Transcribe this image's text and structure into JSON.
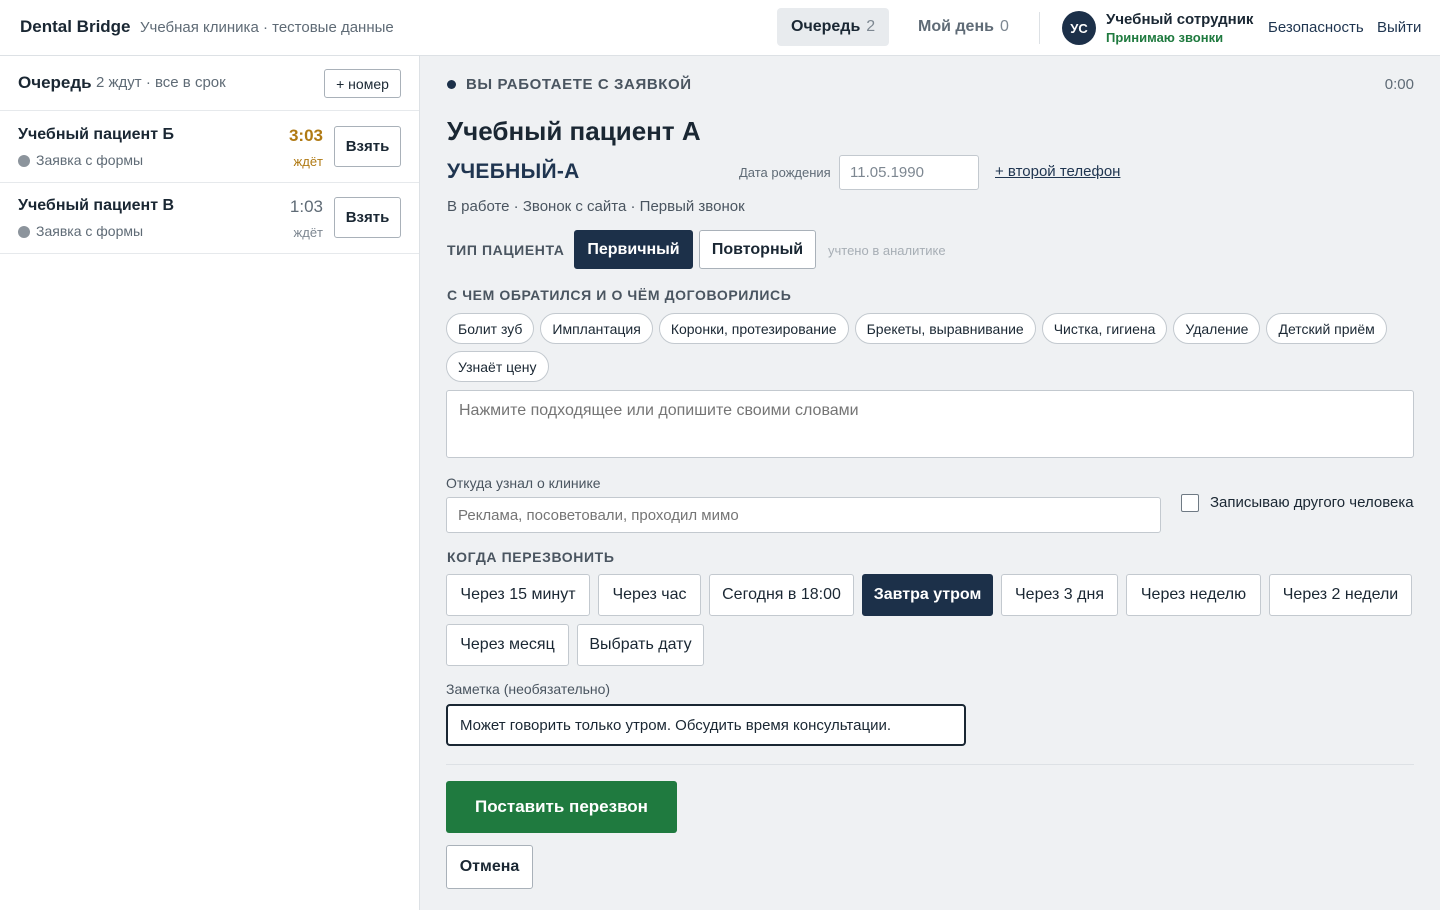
{
  "header": {
    "brand": "Dental Bridge",
    "subtitle": "Учебная клиника · тестовые данные",
    "tabs": [
      {
        "label": "Очередь",
        "count": "2",
        "active": true
      },
      {
        "label": "Мой день",
        "count": "0",
        "active": false
      }
    ],
    "user": {
      "initials": "УС",
      "name": "Учебный сотрудник",
      "status": "Принимаю звонки"
    },
    "links": {
      "security": "Безопасность",
      "logout": "Выйти"
    }
  },
  "sidebar": {
    "title": "Очередь",
    "meta": "2 ждут · все в срок",
    "add_button": "+ номер",
    "items": [
      {
        "name": "Учебный пациент Б",
        "source": "Заявка с формы",
        "time": "3:03",
        "wait": "ждёт",
        "take": "Взять"
      },
      {
        "name": "Учебный пациент В",
        "source": "Заявка с формы",
        "time": "1:03",
        "wait": "ждёт",
        "take": "Взять"
      }
    ]
  },
  "main": {
    "working_label": "ВЫ РАБОТАЕТЕ С ЗАЯВКОЙ",
    "timer": "0:00",
    "patient_name": "Учебный пациент А",
    "patient_code": "УЧЕБНЫЙ-А",
    "dob_label": "Дата рождения",
    "dob_value": "11.05.1990",
    "second_phone": "+ второй телефон",
    "status_line": "В работе · Звонок с сайта · Первый звонок",
    "patient_type": {
      "label": "ТИП ПАЦИЕНТА",
      "options": [
        "Первичный",
        "Повторный"
      ],
      "selected": "Первичный",
      "hint": "учтено в аналитике"
    },
    "reason": {
      "label": "С ЧЕМ ОБРАТИЛСЯ И О ЧЁМ ДОГОВОРИЛИСЬ",
      "chips": [
        "Болит зуб",
        "Имплантация",
        "Коронки, протезирование",
        "Брекеты, выравнивание",
        "Чистка, гигиена",
        "Удаление",
        "Детский приём",
        "Узнаёт цену"
      ],
      "placeholder": "Нажмите подходящее или допишите своими словами"
    },
    "source": {
      "label": "Откуда узнал о клинике",
      "placeholder": "Реклама, посоветовали, проходил мимо"
    },
    "other_person": {
      "label": "Записываю другого человека",
      "checked": false
    },
    "callback": {
      "label": "КОГДА ПЕРЕЗВОНИТЬ",
      "options": [
        "Через 15 минут",
        "Через час",
        "Сегодня в 18:00",
        "Завтра утром",
        "Через 3 дня",
        "Через неделю",
        "Через 2 недели",
        "Через месяц",
        "Выбрать дату"
      ],
      "selected": "Завтра утром"
    },
    "note": {
      "label": "Заметка (необязательно)",
      "value": "Может говорить только утром. Обсудить время консультации."
    },
    "submit": "Поставить перезвон",
    "cancel": "Отмена"
  },
  "colors": {
    "primary": "#1c3049",
    "success": "#1f7a3f",
    "warning": "#b07a14",
    "background": "#eff1f3"
  }
}
